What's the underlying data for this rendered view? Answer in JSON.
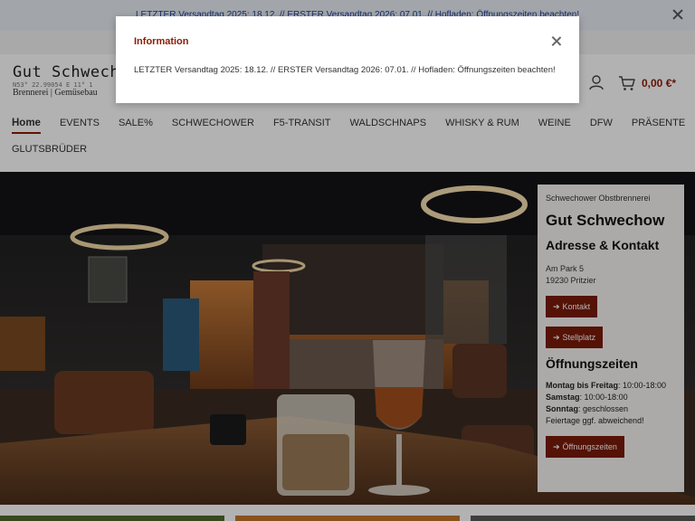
{
  "announcement": {
    "text": "LETZTER Versandtag 2025: 18.12. // ERSTER Versandtag 2026: 07.01. // Hofladen: Öffnungszeiten beachten!"
  },
  "logo": {
    "title": "Gut Schwechow",
    "coords": "N53° 22.99054 E 11° 1",
    "subtitle": "Brennerei | Gemüsebau"
  },
  "cart": {
    "total": "0,00 €*"
  },
  "nav": {
    "row1": [
      "Home",
      "EVENTS",
      "SALE%",
      "SCHWECHOWER",
      "F5-TRANSIT",
      "WALDSCHNAPS",
      "WHISKY & RUM",
      "WEINE",
      "DFW",
      "PRÄSENTE"
    ],
    "row2": [
      "GLUTSBRÜDER"
    ]
  },
  "info_card": {
    "kicker": "Schwechower Obstbrennerei",
    "title": "Gut Schwechow",
    "contact_heading": "Adresse & Kontakt",
    "address_line1": "Am Park 5",
    "address_line2": "19230 Pritzier",
    "btn_contact": "Kontakt",
    "btn_parking": "Stellplatz",
    "hours_heading": "Öffnungszeiten",
    "hours": [
      {
        "label": "Montag bis Freitag",
        "value": ": 10:00-18:00"
      },
      {
        "label": "Samstag",
        "value": ": 10:00-18:00"
      },
      {
        "label": "Sonntag",
        "value": ": geschlossen"
      }
    ],
    "holidays": "Feiertage ggf. abweichend!",
    "btn_hours": "Öffnungszeiten"
  },
  "modal": {
    "title": "Information",
    "body": "LETZTER Versandtag 2025: 18.12. // ERSTER Versandtag 2026: 07.01. // Hofladen: Öffnungszeiten beachten!"
  },
  "colors": {
    "brand": "#8a1c06",
    "button": "#7a1a0a",
    "topbar_text": "#1c3e99"
  },
  "icons": [
    "close-icon",
    "user-icon",
    "cart-icon",
    "arrow-right-icon"
  ]
}
